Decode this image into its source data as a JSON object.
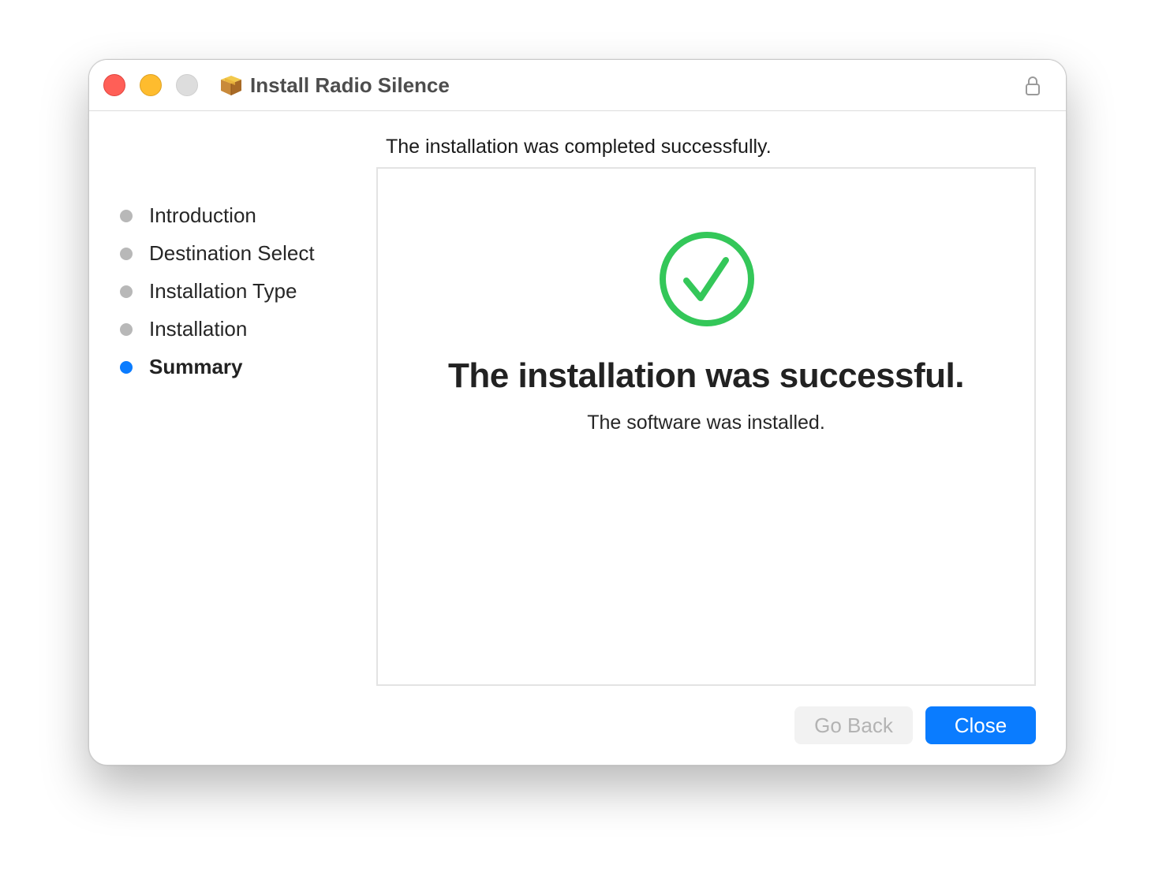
{
  "window": {
    "title": "Install Radio Silence",
    "icon": "package-icon",
    "lock_icon": "lock-icon"
  },
  "header": {
    "message": "The installation was completed successfully."
  },
  "sidebar": {
    "steps": [
      {
        "label": "Introduction",
        "active": false
      },
      {
        "label": "Destination Select",
        "active": false
      },
      {
        "label": "Installation Type",
        "active": false
      },
      {
        "label": "Installation",
        "active": false
      },
      {
        "label": "Summary",
        "active": true
      }
    ]
  },
  "main": {
    "status_icon": "checkmark-circle-icon",
    "title": "The installation was successful.",
    "subtitle": "The software was installed."
  },
  "buttons": {
    "go_back": "Go Back",
    "close": "Close"
  },
  "colors": {
    "accent": "#0a7cff",
    "success": "#34c759",
    "inactive_dot": "#b8b8b8"
  }
}
